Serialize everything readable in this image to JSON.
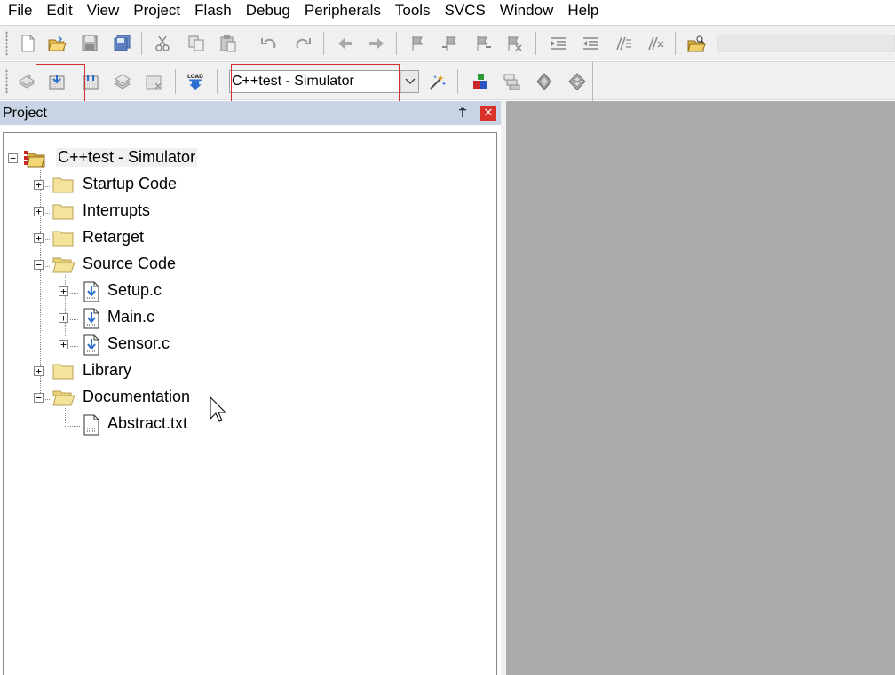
{
  "menu": [
    "File",
    "Edit",
    "View",
    "Project",
    "Flash",
    "Debug",
    "Peripherals",
    "Tools",
    "SVCS",
    "Window",
    "Help"
  ],
  "toolbar1": {
    "icons": [
      "new-file-icon",
      "open-folder-icon",
      "save-icon",
      "save-all-icon",
      "cut-icon",
      "copy-icon",
      "paste-icon",
      "undo-icon",
      "redo-icon",
      "navigate-back-icon",
      "navigate-forward-icon",
      "bookmark-icon",
      "bookmark-prev-icon",
      "bookmark-next-icon",
      "bookmark-clear-icon",
      "indent-icon",
      "unindent-icon",
      "comment-icon",
      "uncomment-icon",
      "find-in-files-icon"
    ]
  },
  "toolbar2": {
    "icons": [
      "translate-icon",
      "build-icon",
      "rebuild-icon",
      "batch-build-icon",
      "stop-build-icon",
      "download-icon",
      "target-options-icon",
      "manage-components-icon",
      "file-extensions-icon",
      "select-packs-icon",
      "pack-installer-icon"
    ],
    "download_label": "LOAD",
    "target_selected": "C++test - Simulator"
  },
  "project_panel": {
    "title": "Project",
    "pin_glyph": "⍑",
    "close_glyph": "✕"
  },
  "tree": {
    "root": "C++test - Simulator",
    "groups": {
      "startup": "Startup Code",
      "interrupts": "Interrupts",
      "retarget": "Retarget",
      "source": "Source Code",
      "library": "Library",
      "documentation": "Documentation"
    },
    "files": {
      "setup": "Setup.c",
      "main": "Main.c",
      "sensor": "Sensor.c",
      "abstract": "Abstract.txt"
    }
  },
  "colors": {
    "panel_header": "#c8d4e3",
    "close_button": "#d9322a",
    "editor_background": "#ababab",
    "highlight_box": "#d03030",
    "folder": "#f3e39b"
  }
}
